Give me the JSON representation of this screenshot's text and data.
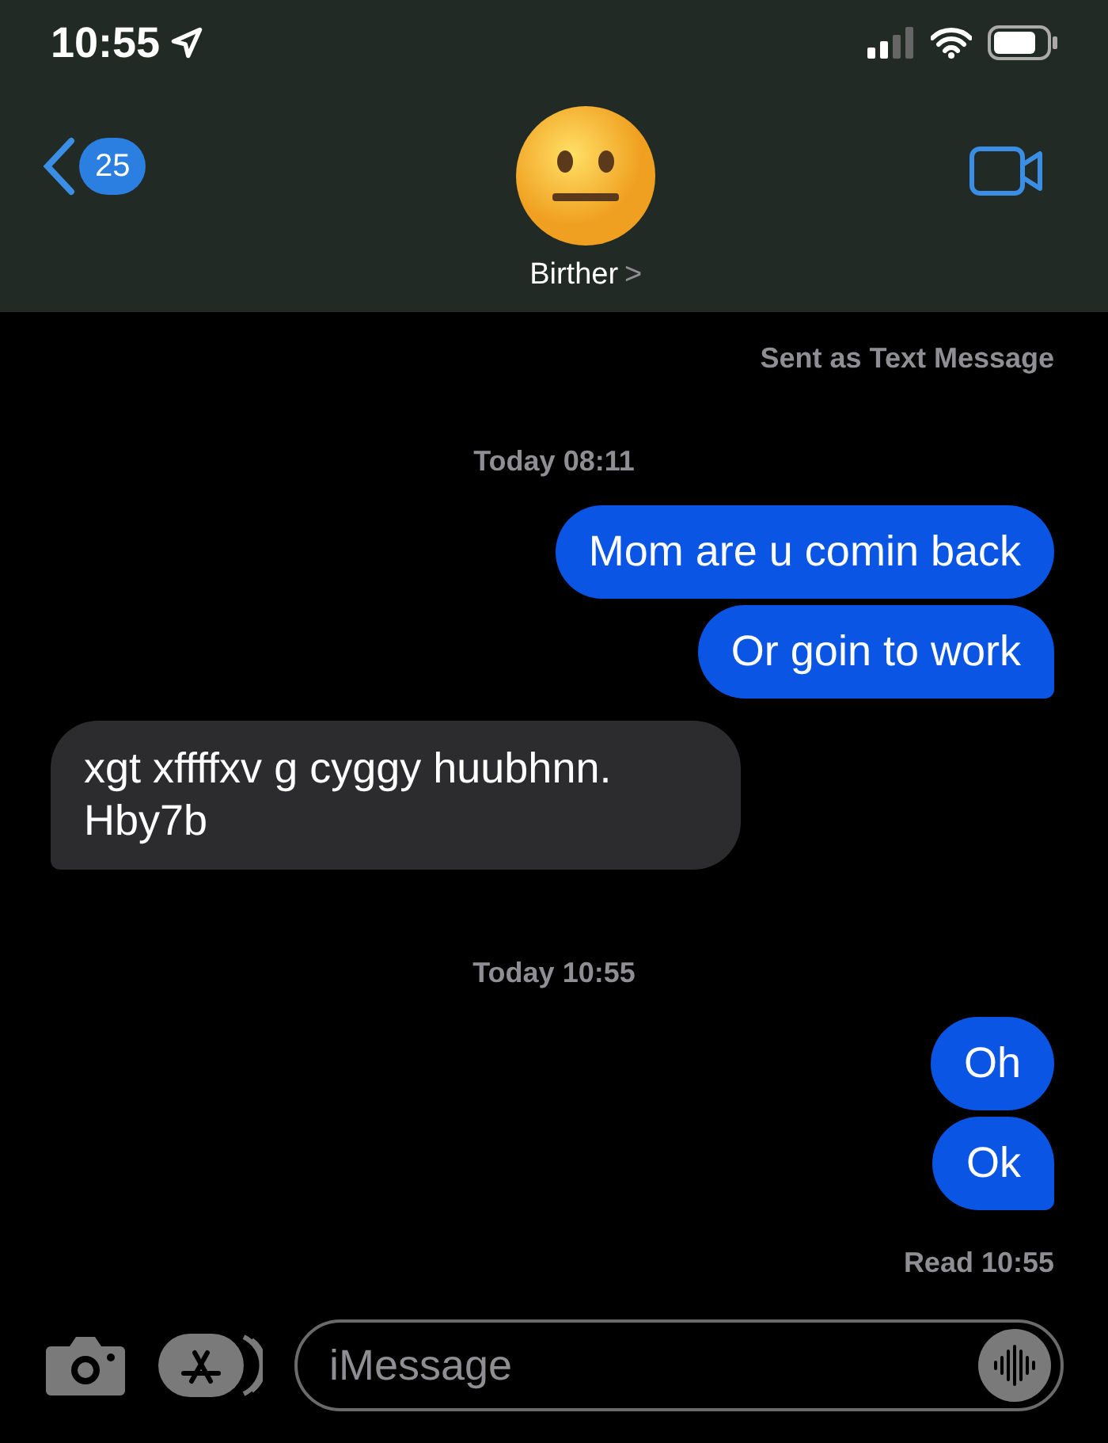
{
  "status_bar": {
    "time": "10:55"
  },
  "header": {
    "back_count": "25",
    "contact": "Birther",
    "chevron": ">"
  },
  "messages": [
    {
      "kind": "status",
      "text": "Sent as Text Message"
    },
    {
      "kind": "time",
      "text": "Today 08:11"
    },
    {
      "kind": "sent",
      "text": "Mom are u comin back",
      "tail": false
    },
    {
      "kind": "sent",
      "text": "Or goin to work",
      "tail": true
    },
    {
      "kind": "received",
      "text": "xgt xffffxv g cyggy huubhnn. Hby7b",
      "tail": true
    },
    {
      "kind": "time",
      "text": "Today 10:55"
    },
    {
      "kind": "sent",
      "text": "Oh",
      "tail": false
    },
    {
      "kind": "sent",
      "text": "Ok",
      "tail": true
    },
    {
      "kind": "status",
      "text": "Read 10:55"
    }
  ],
  "composer": {
    "placeholder": "iMessage"
  }
}
